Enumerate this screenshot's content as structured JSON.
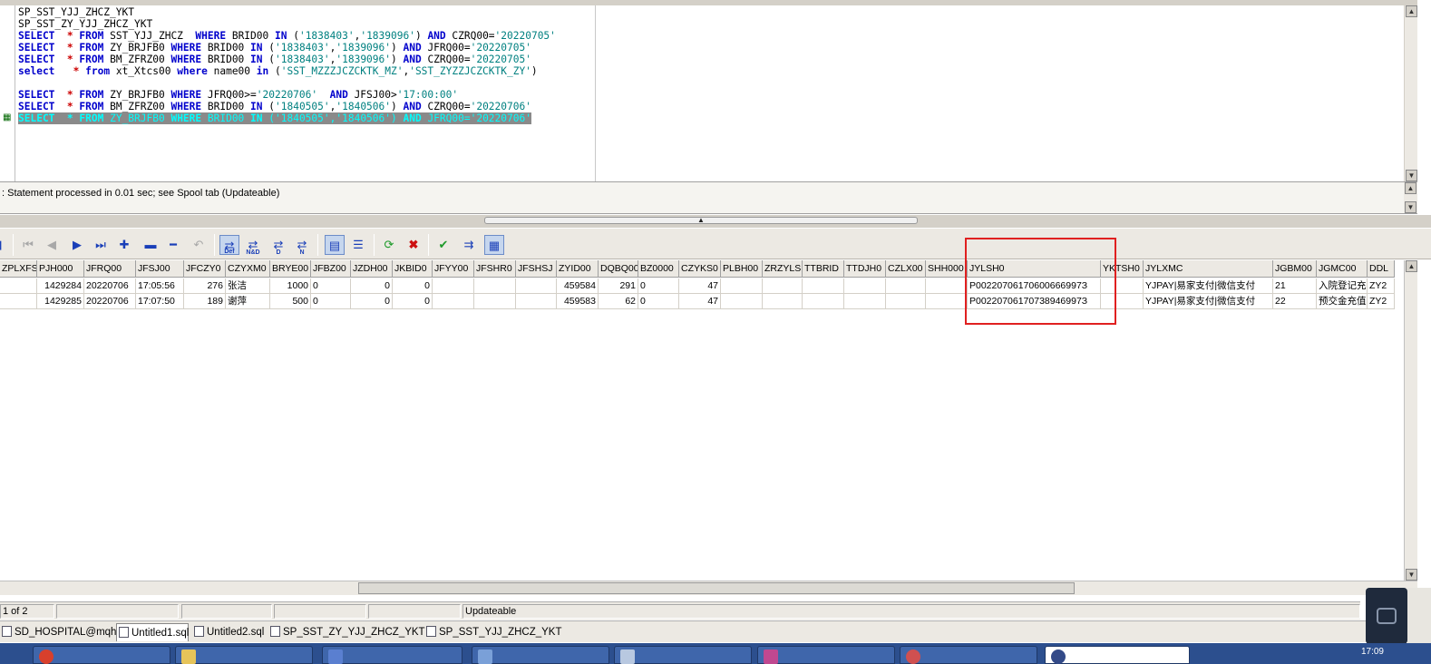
{
  "editor": {
    "lines": [
      [
        {
          "t": "SP_SST_YJJ_ZHCZ_YKT",
          "c": ""
        }
      ],
      [
        {
          "t": "SP_SST_ZY_YJJ_ZHCZ_YKT",
          "c": ""
        }
      ],
      [
        {
          "t": "SELECT",
          "c": "kw"
        },
        {
          "t": "  ",
          "c": ""
        },
        {
          "t": "*",
          "c": "star"
        },
        {
          "t": " ",
          "c": ""
        },
        {
          "t": "FROM",
          "c": "kw"
        },
        {
          "t": " SST_YJJ_ZHCZ  ",
          "c": ""
        },
        {
          "t": "WHERE",
          "c": "kw"
        },
        {
          "t": " BRID00 ",
          "c": ""
        },
        {
          "t": "IN",
          "c": "kw"
        },
        {
          "t": " (",
          "c": ""
        },
        {
          "t": "'1838403'",
          "c": "str"
        },
        {
          "t": ",",
          "c": ""
        },
        {
          "t": "'1839096'",
          "c": "str"
        },
        {
          "t": ") ",
          "c": ""
        },
        {
          "t": "AND",
          "c": "kw"
        },
        {
          "t": " CZRQ00=",
          "c": ""
        },
        {
          "t": "'20220705'",
          "c": "str"
        }
      ],
      [
        {
          "t": "SELECT",
          "c": "kw"
        },
        {
          "t": "  ",
          "c": ""
        },
        {
          "t": "*",
          "c": "star"
        },
        {
          "t": " ",
          "c": ""
        },
        {
          "t": "FROM",
          "c": "kw"
        },
        {
          "t": " ZY_BRJFB0 ",
          "c": ""
        },
        {
          "t": "WHERE",
          "c": "kw"
        },
        {
          "t": " BRID00 ",
          "c": ""
        },
        {
          "t": "IN",
          "c": "kw"
        },
        {
          "t": " (",
          "c": ""
        },
        {
          "t": "'1838403'",
          "c": "str"
        },
        {
          "t": ",",
          "c": ""
        },
        {
          "t": "'1839096'",
          "c": "str"
        },
        {
          "t": ") ",
          "c": ""
        },
        {
          "t": "AND",
          "c": "kw"
        },
        {
          "t": " JFRQ00=",
          "c": ""
        },
        {
          "t": "'20220705'",
          "c": "str"
        }
      ],
      [
        {
          "t": "SELECT",
          "c": "kw"
        },
        {
          "t": "  ",
          "c": ""
        },
        {
          "t": "*",
          "c": "star"
        },
        {
          "t": " ",
          "c": ""
        },
        {
          "t": "FROM",
          "c": "kw"
        },
        {
          "t": " BM_ZFRZ00 ",
          "c": ""
        },
        {
          "t": "WHERE",
          "c": "kw"
        },
        {
          "t": " BRID00 ",
          "c": ""
        },
        {
          "t": "IN",
          "c": "kw"
        },
        {
          "t": " (",
          "c": ""
        },
        {
          "t": "'1838403'",
          "c": "str"
        },
        {
          "t": ",",
          "c": ""
        },
        {
          "t": "'1839096'",
          "c": "str"
        },
        {
          "t": ") ",
          "c": ""
        },
        {
          "t": "AND",
          "c": "kw"
        },
        {
          "t": " CZRQ00=",
          "c": ""
        },
        {
          "t": "'20220705'",
          "c": "str"
        }
      ],
      [
        {
          "t": "select",
          "c": "kwl"
        },
        {
          "t": "   ",
          "c": ""
        },
        {
          "t": "*",
          "c": "star"
        },
        {
          "t": " ",
          "c": ""
        },
        {
          "t": "from",
          "c": "kwl"
        },
        {
          "t": " xt_Xtcs00 ",
          "c": ""
        },
        {
          "t": "where",
          "c": "kwl"
        },
        {
          "t": " name00 ",
          "c": ""
        },
        {
          "t": "in",
          "c": "kwl"
        },
        {
          "t": " (",
          "c": ""
        },
        {
          "t": "'SST_MZZZJCZCKTK_MZ'",
          "c": "str"
        },
        {
          "t": ",",
          "c": ""
        },
        {
          "t": "'SST_ZYZZJCZCKTK_ZY'",
          "c": "str"
        },
        {
          "t": ")",
          "c": ""
        }
      ],
      [],
      [
        {
          "t": "SELECT",
          "c": "kw"
        },
        {
          "t": "  ",
          "c": ""
        },
        {
          "t": "*",
          "c": "star"
        },
        {
          "t": " ",
          "c": ""
        },
        {
          "t": "FROM",
          "c": "kw"
        },
        {
          "t": " ZY_BRJFB0 ",
          "c": ""
        },
        {
          "t": "WHERE",
          "c": "kw"
        },
        {
          "t": " JFRQ00>=",
          "c": ""
        },
        {
          "t": "'20220706'",
          "c": "str"
        },
        {
          "t": "  ",
          "c": ""
        },
        {
          "t": "AND",
          "c": "kw"
        },
        {
          "t": " JFSJ00>",
          "c": ""
        },
        {
          "t": "'17:00:00'",
          "c": "str"
        }
      ],
      [
        {
          "t": "SELECT",
          "c": "kw"
        },
        {
          "t": "  ",
          "c": ""
        },
        {
          "t": "*",
          "c": "star"
        },
        {
          "t": " ",
          "c": ""
        },
        {
          "t": "FROM",
          "c": "kw"
        },
        {
          "t": " BM_ZFRZ00 ",
          "c": ""
        },
        {
          "t": "WHERE",
          "c": "kw"
        },
        {
          "t": " BRID00 ",
          "c": ""
        },
        {
          "t": "IN",
          "c": "kw"
        },
        {
          "t": " (",
          "c": ""
        },
        {
          "t": "'1840505'",
          "c": "str"
        },
        {
          "t": ",",
          "c": ""
        },
        {
          "t": "'1840506'",
          "c": "str"
        },
        {
          "t": ") ",
          "c": ""
        },
        {
          "t": "AND",
          "c": "kw"
        },
        {
          "t": " CZRQ00=",
          "c": ""
        },
        {
          "t": "'20220706'",
          "c": "str"
        }
      ],
      [
        {
          "t": "SELECT",
          "c": "kw"
        },
        {
          "t": "  ",
          "c": ""
        },
        {
          "t": "*",
          "c": "star"
        },
        {
          "t": " ",
          "c": ""
        },
        {
          "t": "FROM",
          "c": "kw"
        },
        {
          "t": " ZY_BRJFB0 ",
          "c": ""
        },
        {
          "t": "WHERE",
          "c": "kw"
        },
        {
          "t": " BRID00 ",
          "c": ""
        },
        {
          "t": "IN",
          "c": "kw"
        },
        {
          "t": " (",
          "c": ""
        },
        {
          "t": "'1840505'",
          "c": "str"
        },
        {
          "t": ",",
          "c": ""
        },
        {
          "t": "'1840506'",
          "c": "str"
        },
        {
          "t": ") ",
          "c": ""
        },
        {
          "t": "AND",
          "c": "kw"
        },
        {
          "t": " JFRQ00=",
          "c": ""
        },
        {
          "t": "'20220706'",
          "c": "str"
        }
      ]
    ],
    "selected_line": 9
  },
  "status": {
    "message": ": Statement processed in 0.01 sec; see Spool tab (Updateable)"
  },
  "toolbar": {
    "def_label": "Def",
    "nd_label": "N&D",
    "d_label": "D",
    "n_label": "N"
  },
  "grid": {
    "columns": [
      "ZPLXFS",
      "PJH000",
      "JFRQ00",
      "JFSJ00",
      "JFCZY0",
      "CZYXM0",
      "BRYE00",
      "JFBZ00",
      "JZDH00",
      "JKBID0",
      "JFYY00",
      "JFSHR0",
      "JFSHSJ",
      "ZYID00",
      "DQBQ00",
      "BZ0000",
      "CZYKS0",
      "PLBH00",
      "ZRZYLS",
      "TTBRID",
      "TTDJH0",
      "CZLX00",
      "SHH000",
      "JYLSH0",
      "YKTSH0",
      "JYLXMC",
      "JGBM00",
      "JGMC00",
      "DDL"
    ],
    "rows": [
      [
        "",
        "1429284",
        "20220706",
        "17:05:56",
        "276",
        "张洁",
        "1000",
        "0",
        "0",
        "0",
        "",
        "",
        "",
        "459584",
        "291",
        "0",
        "47",
        "",
        "",
        "",
        "",
        "",
        "",
        "P00220706170600666997З",
        "",
        "YJPAY|易家支付|微信支付",
        "21",
        "入院登记充",
        "ZY2"
      ],
      [
        "",
        "1429285",
        "20220706",
        "17:07:50",
        "189",
        "谢萍",
        "500",
        "0",
        "0",
        "0",
        "",
        "",
        "",
        "459583",
        "62",
        "0",
        "47",
        "",
        "",
        "",
        "",
        "",
        "",
        "P00220706170738946997З",
        "",
        "YJPAY|易家支付|微信支付",
        "22",
        "预交金充值",
        "ZY2"
      ]
    ]
  },
  "recbar": {
    "position": "1 of 2",
    "mode": "Updateable"
  },
  "window_tabs": [
    {
      "label": "SD_HOSPITAL@mqhis",
      "active": false
    },
    {
      "label": "Untitled1.sql",
      "active": true
    },
    {
      "label": "Untitled2.sql",
      "active": false
    },
    {
      "label": "SP_SST_ZY_YJJ_ZHCZ_YKT",
      "active": false
    },
    {
      "label": "SP_SST_YJJ_ZHCZ_YKT",
      "active": false
    }
  ],
  "taskbar": {
    "clock": "17:09"
  }
}
